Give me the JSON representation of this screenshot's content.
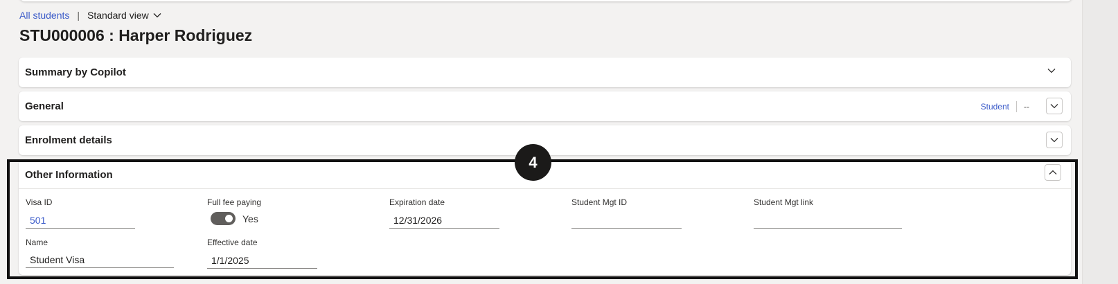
{
  "breadcrumb": {
    "all_students": "All students",
    "separator": "|",
    "view": "Standard view"
  },
  "page_title": "STU000006 : Harper Rodriguez",
  "sections": {
    "summary": {
      "title": "Summary by Copilot"
    },
    "general": {
      "title": "General",
      "tag": "Student",
      "value": "--"
    },
    "enrolment": {
      "title": "Enrolment details"
    },
    "other": {
      "title": "Other Information"
    }
  },
  "step_badge": "4",
  "fields": {
    "visa_id": {
      "label": "Visa ID",
      "value": "501"
    },
    "full_fee": {
      "label": "Full fee paying",
      "value": "Yes",
      "on": true
    },
    "expiration": {
      "label": "Expiration date",
      "value": "12/31/2026"
    },
    "student_mgt_id": {
      "label": "Student Mgt ID",
      "value": ""
    },
    "student_mgt_link": {
      "label": "Student Mgt link",
      "value": ""
    },
    "name": {
      "label": "Name",
      "value": "Student Visa"
    },
    "effective": {
      "label": "Effective date",
      "value": "1/1/2025"
    }
  },
  "colors": {
    "link": "#3b5bc9",
    "background": "#f3f2f1",
    "highlight_border": "#111111",
    "badge": "#1b1a19",
    "toggle_on": "#605e5c"
  },
  "icons": {
    "view_dropdown": "chevron-down-icon",
    "expand": "chevron-down-icon",
    "collapse": "chevron-up-icon"
  }
}
